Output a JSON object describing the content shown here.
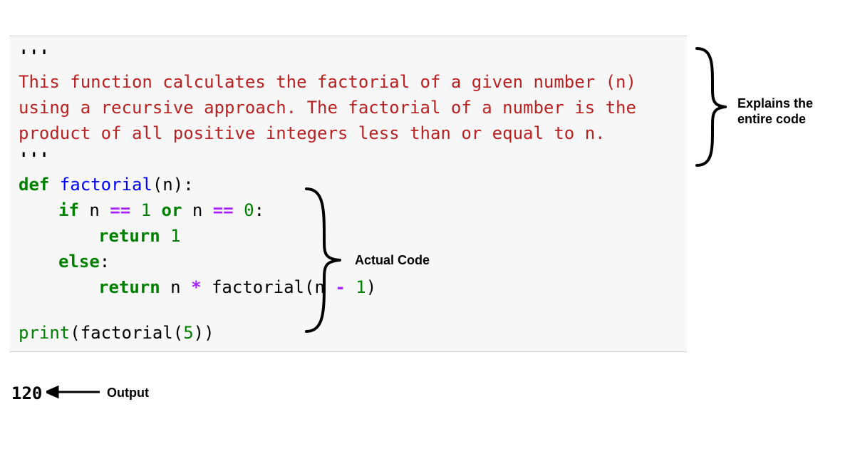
{
  "code": {
    "docstring_open": "'''",
    "docstring_line1": "This function calculates the factorial of a given number (n)",
    "docstring_line2": "using a recursive approach. The factorial of a number is the",
    "docstring_line3": "product of all positive integers less than or equal to n.",
    "docstring_close": "'''",
    "def_kw": "def",
    "func_name": " factorial",
    "def_params": "(n):",
    "if_kw": "if",
    "if_cond_n1": " n ",
    "if_op1": "==",
    "if_num1": " 1 ",
    "or_kw": "or",
    "if_cond_n2": " n ",
    "if_op2": "==",
    "if_num2": " 0",
    "colon1": ":",
    "return1_kw": "return",
    "return1_val": " 1",
    "else_kw": "else",
    "colon2": ":",
    "return2_kw": "return",
    "return2_expr1": " n ",
    "return2_op": "*",
    "return2_expr2": " factorial(n ",
    "return2_minus": "-",
    "return2_expr3": " 1",
    "return2_close": ")",
    "print_fn": "print",
    "print_call": "(factorial(",
    "print_arg": "5",
    "print_close": "))"
  },
  "output": "120",
  "annotations": {
    "explains": "Explains the\nentire code",
    "actual_code": "Actual Code",
    "output_label": "Output"
  }
}
